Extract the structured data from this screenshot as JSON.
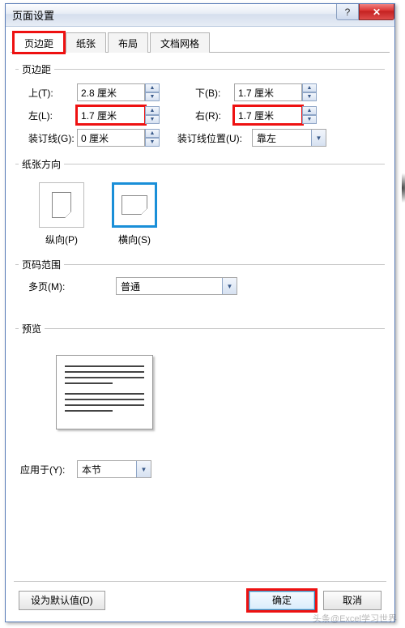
{
  "window": {
    "title": "页面设置",
    "help": "?",
    "close": "✕"
  },
  "tabs": [
    "页边距",
    "纸张",
    "布局",
    "文档网格"
  ],
  "groups": {
    "margins": "页边距",
    "orientation": "纸张方向",
    "pages": "页码范围",
    "preview": "预览"
  },
  "margins": {
    "top_label": "上(T):",
    "top_value": "2.8 厘米",
    "bottom_label": "下(B):",
    "bottom_value": "1.7 厘米",
    "left_label": "左(L):",
    "left_value": "1.7 厘米",
    "right_label": "右(R):",
    "right_value": "1.7 厘米",
    "gutter_label": "装订线(G):",
    "gutter_value": "0 厘米",
    "gutter_pos_label": "装订线位置(U):",
    "gutter_pos_value": "靠左"
  },
  "orientation": {
    "portrait": "纵向(P)",
    "landscape": "横向(S)"
  },
  "pages": {
    "multi_label": "多页(M):",
    "multi_value": "普通"
  },
  "apply": {
    "label": "应用于(Y):",
    "value": "本节"
  },
  "buttons": {
    "default": "设为默认值(D)",
    "ok": "确定",
    "cancel": "取消"
  },
  "watermark": "头条@Excel学习世界"
}
